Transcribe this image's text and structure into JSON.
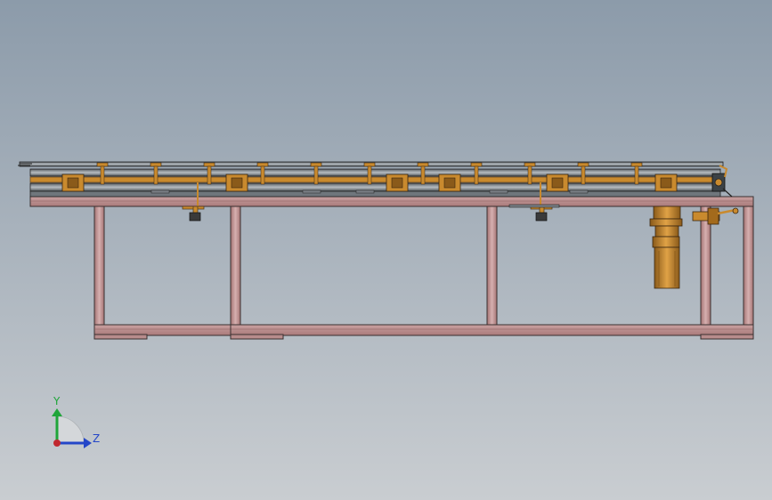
{
  "viewport": {
    "background_top": "#8C9BAA",
    "background_bottom": "#C9CDD1",
    "frame_color": "#B98A8A",
    "frame_edge": "#3A3030",
    "conveyor_color": "#C98A2E",
    "conveyor_dark": "#6B4A22",
    "rail_color": "#8E949A"
  },
  "triad": {
    "y_label": "Y",
    "z_label": "Z",
    "y_color": "#1FA53A",
    "z_color": "#2446C8",
    "origin_color": "#C0282F"
  }
}
